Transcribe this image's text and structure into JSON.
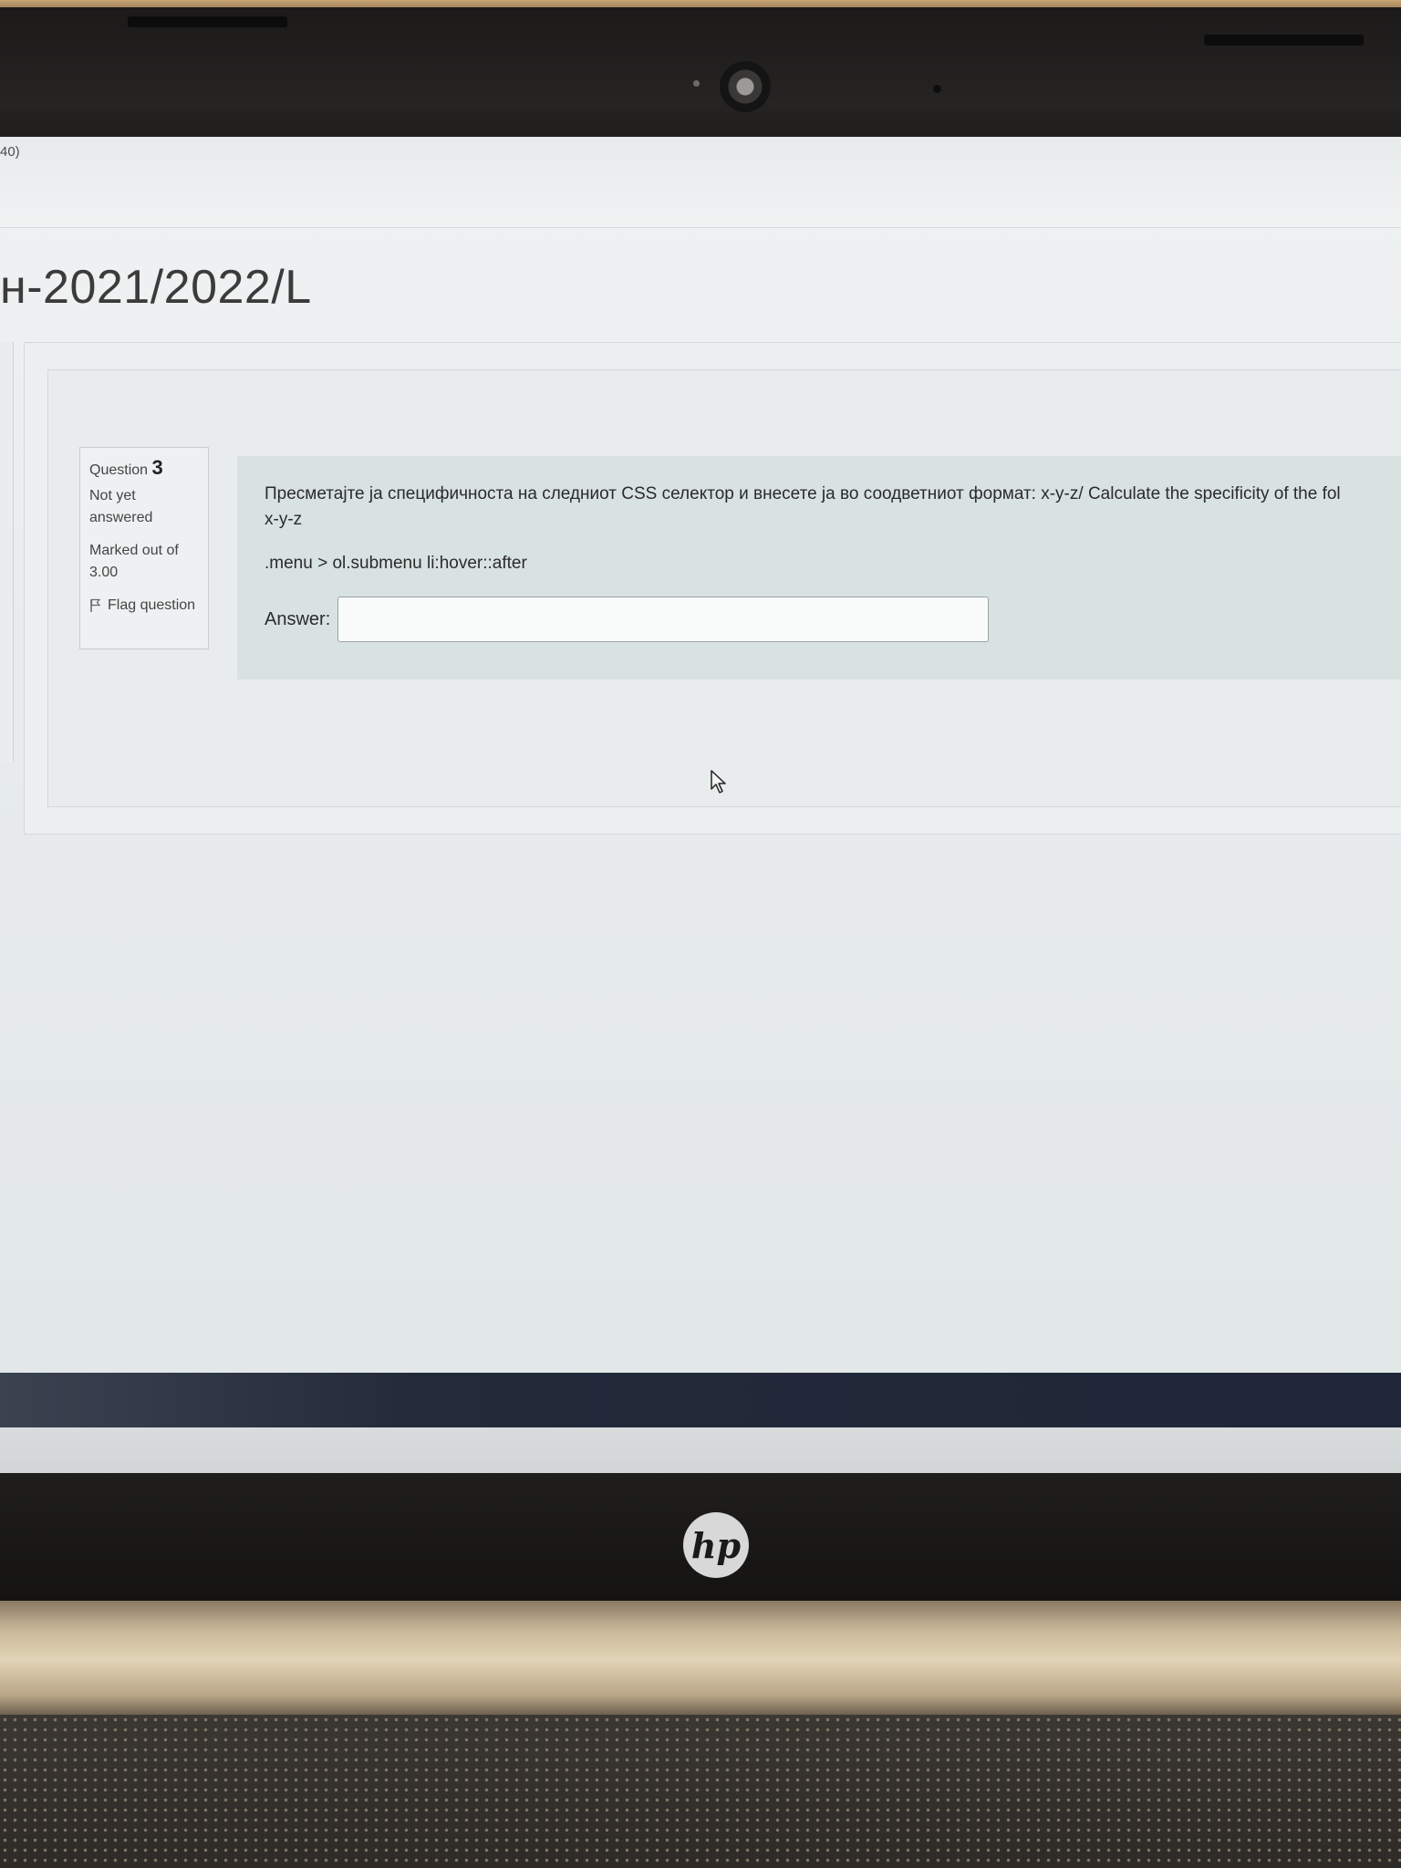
{
  "page": {
    "counter_fragment": "40)",
    "course_title": "н-2021/2022/L"
  },
  "question_info": {
    "label": "Question",
    "number": "3",
    "state": "Not yet answered",
    "grade": "Marked out of 3.00",
    "flag_label": "Flag question"
  },
  "question": {
    "text": "Пресметајте ја специфичноста на следниот CSS селектор и внесете ја во соодветниот формат: x-y-z/ Calculate the specificity of the fol",
    "format": "x-y-z",
    "selector": ".menu > ol.submenu li:hover::after",
    "answer_label": "Answer:",
    "answer_value": ""
  },
  "device": {
    "brand_logo": "hp"
  },
  "colors": {
    "question_content_bg": "#d7e2e1",
    "screen_bg": "#eceff0",
    "taskbar": "#232a3a"
  }
}
